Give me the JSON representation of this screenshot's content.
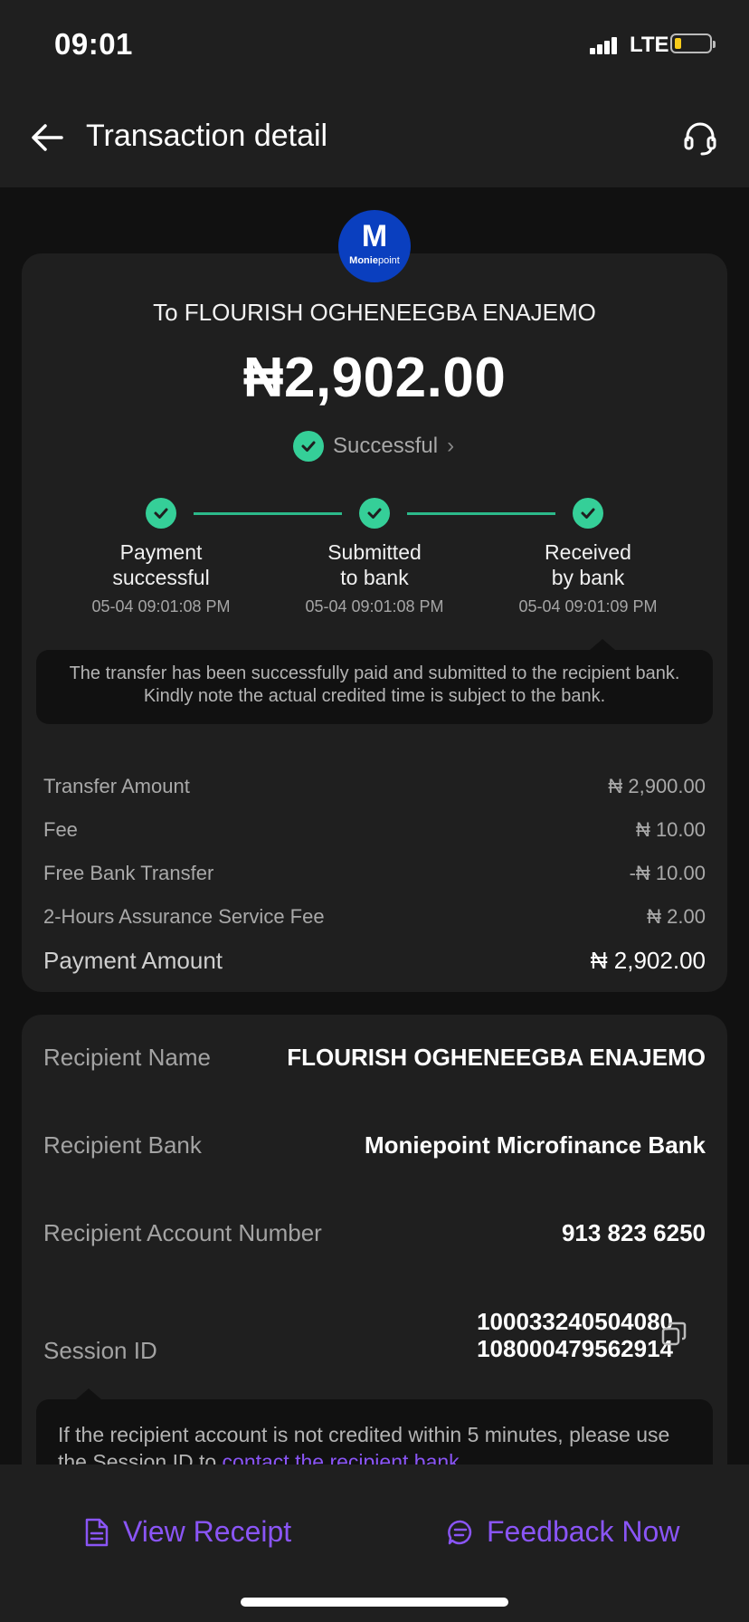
{
  "status_bar": {
    "time": "09:01",
    "network": "LTE"
  },
  "header": {
    "title": "Transaction detail"
  },
  "logo": {
    "letter": "M",
    "brand_bold": "Monie",
    "brand_light": "point"
  },
  "transaction": {
    "to_label": "To FLOURISH OGHENEEGBA ENAJEMO",
    "amount": "₦2,902.00",
    "status": "Successful"
  },
  "steps": [
    {
      "label_1": "Payment",
      "label_2": "successful",
      "time": "05-04 09:01:08 PM"
    },
    {
      "label_1": "Submitted",
      "label_2": "to bank",
      "time": "05-04 09:01:08 PM"
    },
    {
      "label_1": "Received",
      "label_2": "by bank",
      "time": "05-04 09:01:09 PM"
    }
  ],
  "step_note": "The transfer has been successfully paid and submitted to the recipient bank. Kindly note the actual credited time is subject to the bank.",
  "fees": [
    {
      "label": "Transfer Amount",
      "value": "₦ 2,900.00"
    },
    {
      "label": "Fee",
      "value": "₦ 10.00"
    },
    {
      "label": "Free Bank Transfer",
      "value": "-₦ 10.00"
    },
    {
      "label": "2-Hours Assurance Service Fee",
      "value": "₦ 2.00"
    },
    {
      "label": "Payment Amount",
      "value": "₦ 2,902.00"
    }
  ],
  "recipient": {
    "name_label": "Recipient Name",
    "name": "FLOURISH OGHENEEGBA ENAJEMO",
    "bank_label": "Recipient Bank",
    "bank": "Moniepoint Microfinance Bank",
    "account_label": "Recipient Account Number",
    "account": "913 823 6250",
    "session_label": "Session ID",
    "session_line1": "100033240504080",
    "session_line2": "108000479562914"
  },
  "session_note": {
    "text_1": "If the recipient account is not credited within 5 minutes, please use",
    "text_2": "the Session ID to ",
    "link": "contact the recipient bank"
  },
  "actions": {
    "receipt": "View Receipt",
    "feedback": "Feedback Now"
  },
  "colors": {
    "accent": "#8a55f6",
    "success": "#35cf98",
    "card": "#1f1f1f",
    "background": "#111111"
  }
}
